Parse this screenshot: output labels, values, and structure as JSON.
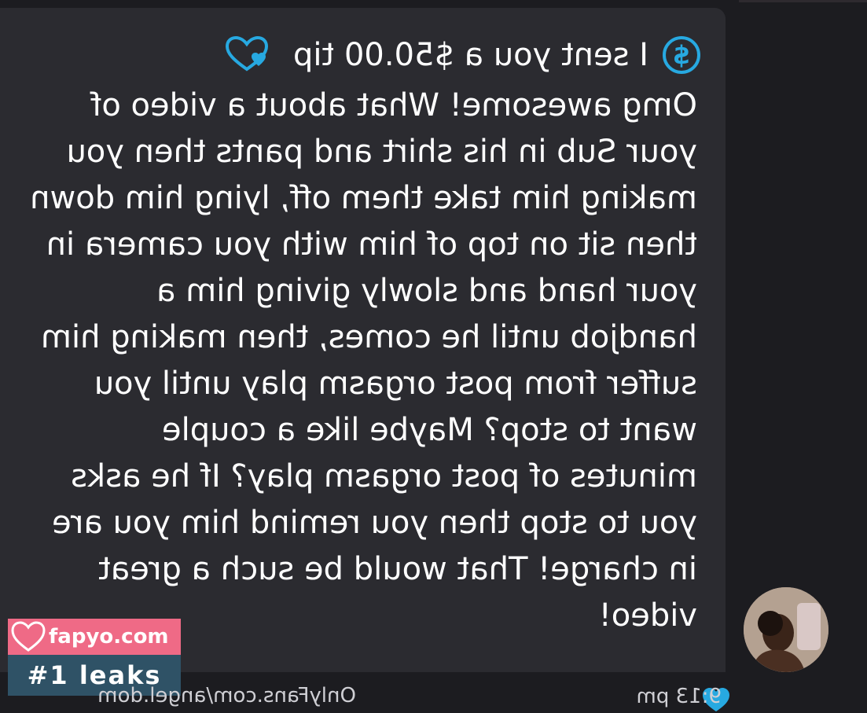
{
  "message": {
    "tip_text": "I sent you a $50.00 tip",
    "dollar_symbol": "$",
    "text": "Omg awesome! What about a video of your Sub in his shirt and pants then you making him take them off, lying him down then sit on top of him with you camera in your hand and slowly giving him a handjob until he comes, then making him suffer from post orgasm play until you want to stop? Maybe like a couple minutes of post orgasm play? If he asks you to stop then you remind him you are in charge! That would be such a great video!",
    "time": "9:13 pm",
    "source_text": "OnlyFans.com/angel.dom"
  },
  "watermark": {
    "site": "fapyo.com",
    "tagline": "#1 leaks"
  },
  "colors": {
    "accent": "#27a9e1",
    "bubble": "#2b2b30",
    "background": "#1c1c20",
    "watermark_pink": "#ef6a86",
    "watermark_blue": "#2f5266"
  },
  "icons": {
    "dollar": "dollar-circle-icon",
    "tip_heart": "heart-outline-icon",
    "liked": "heart-filled-icon"
  }
}
